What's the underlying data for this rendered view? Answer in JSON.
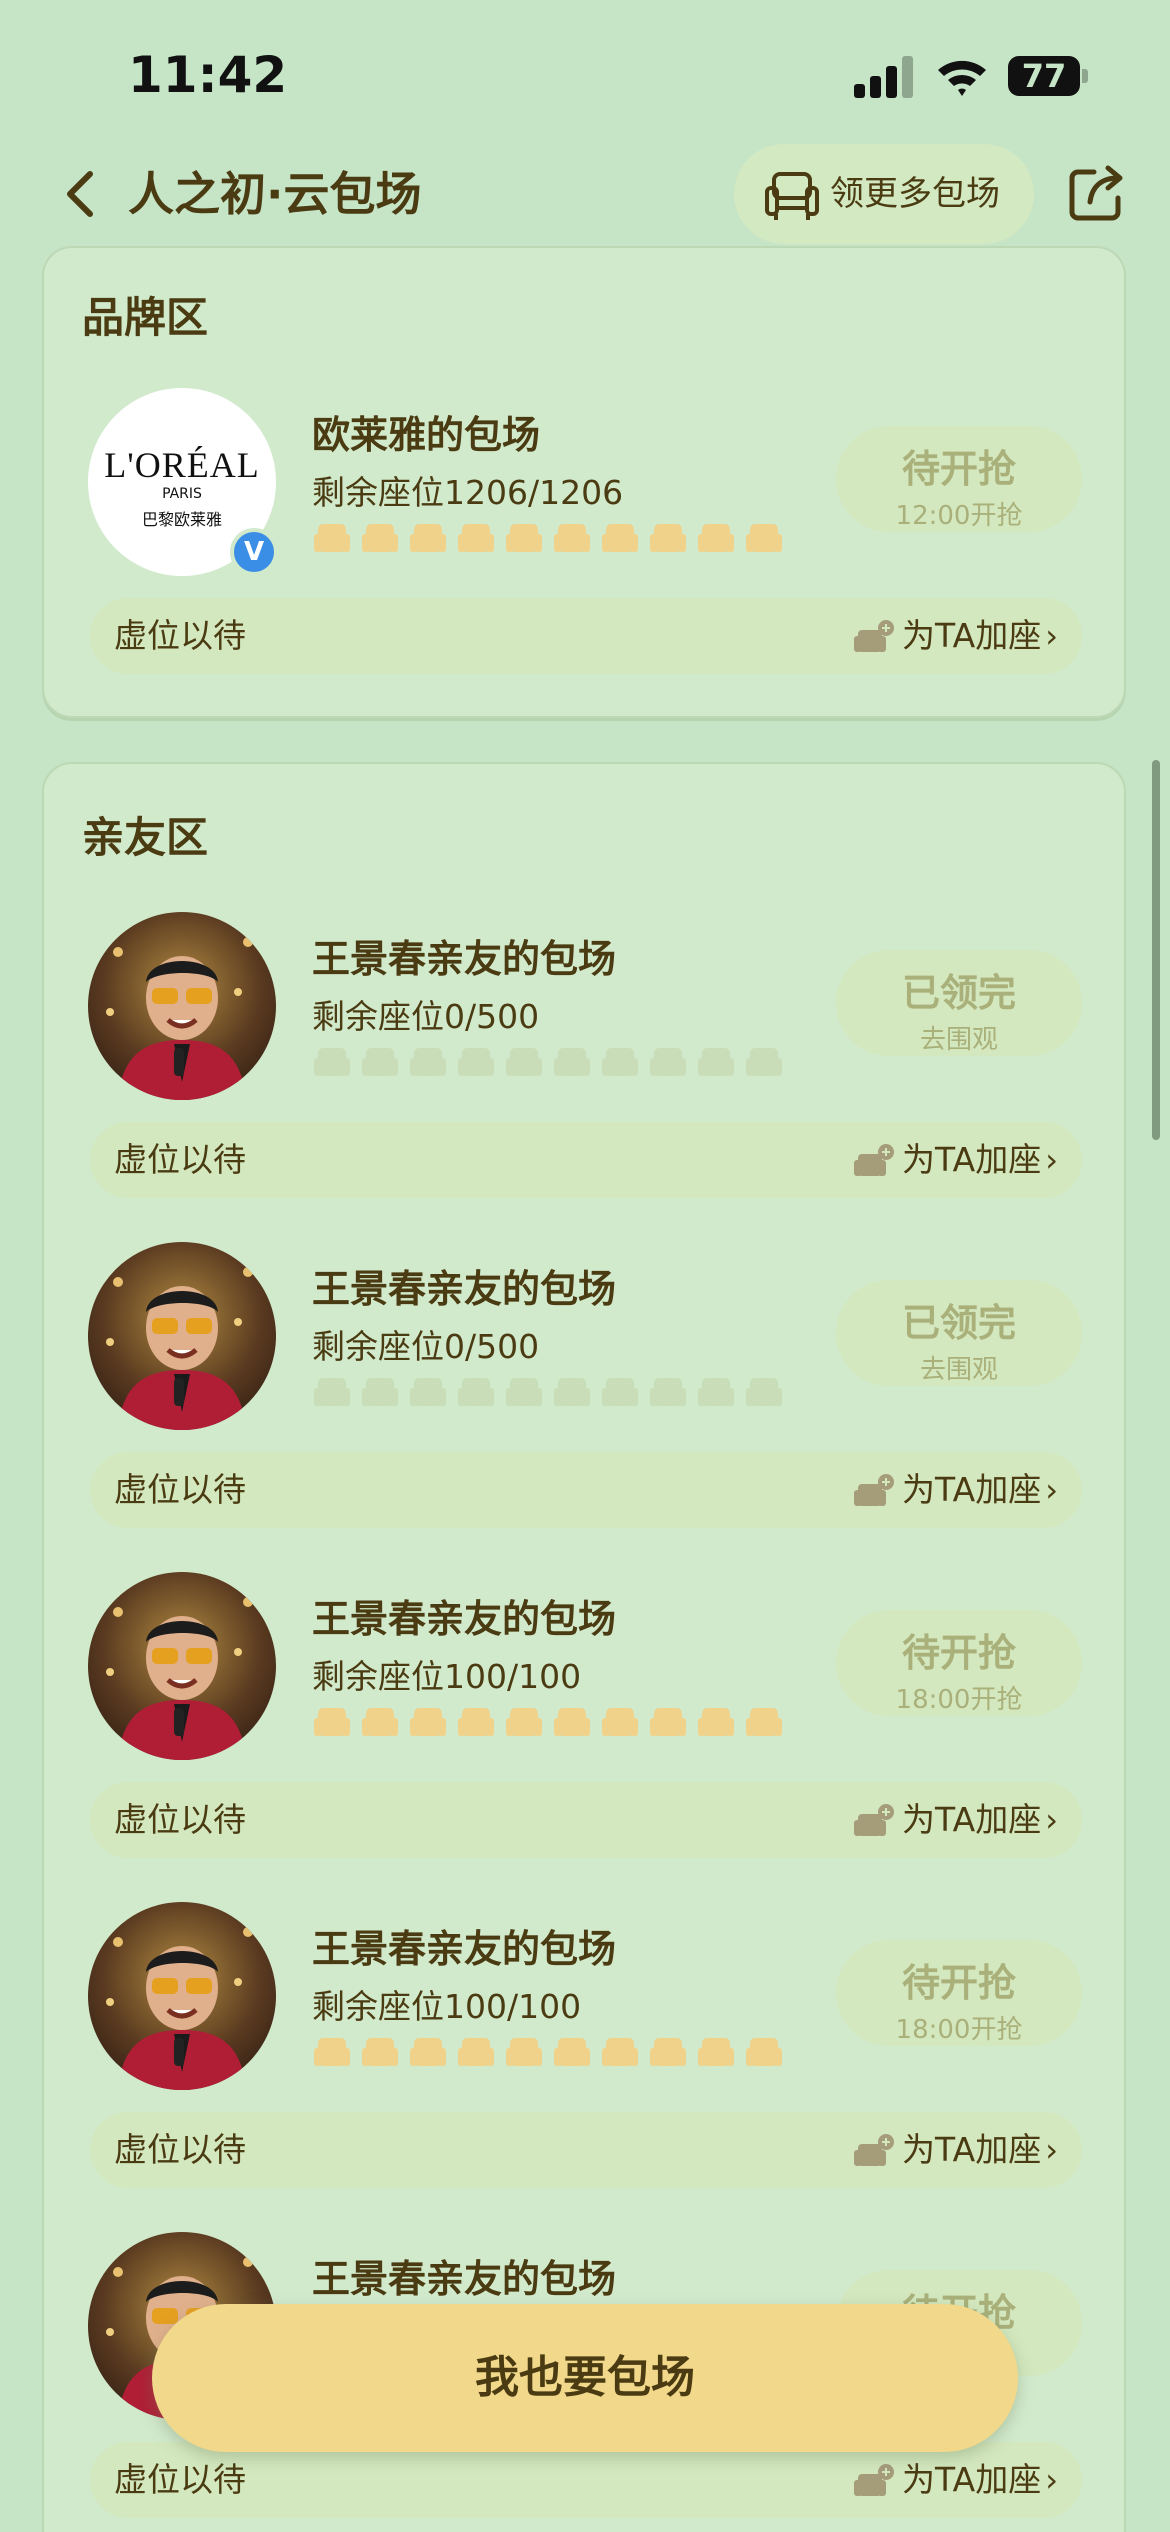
{
  "status_bar": {
    "time": "11:42",
    "battery": "77"
  },
  "header": {
    "title": "人之初·云包场",
    "more_label": "领更多包场"
  },
  "brand_section": {
    "title": "品牌区",
    "card": {
      "logo_text": "L'ORÉAL",
      "logo_sub": "PARIS",
      "logo_cn": "巴黎欧莱雅",
      "verified_badge": "V",
      "name": "欧莱雅的包场",
      "seats": "剩余座位1206/1206",
      "status_main": "待开抢",
      "status_sub": "12:00开抢",
      "bar_left": "虚位以待",
      "bar_right": "为TA加座"
    }
  },
  "friends_section": {
    "title": "亲友区",
    "cards": [
      {
        "name": "王景春亲友的包场",
        "seats": "剩余座位0/500",
        "status_main": "已领完",
        "status_sub": "去围观",
        "bar_left": "虚位以待",
        "bar_right": "为TA加座"
      },
      {
        "name": "王景春亲友的包场",
        "seats": "剩余座位0/500",
        "status_main": "已领完",
        "status_sub": "去围观",
        "bar_left": "虚位以待",
        "bar_right": "为TA加座"
      },
      {
        "name": "王景春亲友的包场",
        "seats": "剩余座位100/100",
        "status_main": "待开抢",
        "status_sub": "18:00开抢",
        "bar_left": "虚位以待",
        "bar_right": "为TA加座"
      },
      {
        "name": "王景春亲友的包场",
        "seats": "剩余座位100/100",
        "status_main": "待开抢",
        "status_sub": "18:00开抢",
        "bar_left": "虚位以待",
        "bar_right": "为TA加座"
      },
      {
        "name": "王景春亲友的包场",
        "seats": "",
        "status_main": "待开抢",
        "status_sub": "",
        "bar_left": "虚位以待",
        "bar_right": "为TA加座"
      }
    ]
  },
  "cta_label": "我也要包场",
  "colors": {
    "background": "#c6e4c6",
    "card": "#d2eacc",
    "accent": "#f2d88a",
    "text": "#4a3b12",
    "seat_available": "#f0d28a",
    "seat_empty": "#c9ddb9"
  },
  "icons": [
    "back-icon",
    "sofa-icon",
    "share-icon",
    "seat-icon",
    "add-seat-icon",
    "chevron-right-icon",
    "verified-icon"
  ]
}
